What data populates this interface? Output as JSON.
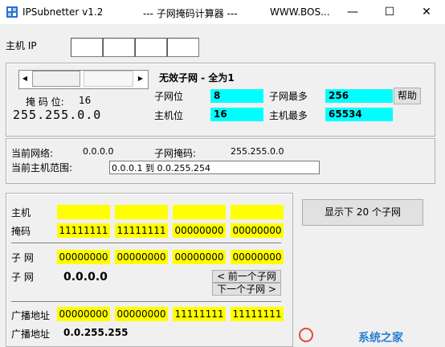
{
  "window": {
    "app_title": "IPSubnetter v1.2",
    "subtitle": "--- 子网掩码计算器 ---",
    "site": "WWW.BOS...",
    "minimize_glyph": "—",
    "maximize_glyph": "☐",
    "close_glyph": "✕"
  },
  "host_ip": {
    "label": "主机 IP",
    "octets": [
      "",
      "",
      "",
      ""
    ]
  },
  "mask_panel": {
    "scroll_left": "◀",
    "scroll_right": "▶",
    "status": "无效子网 - 全为1",
    "mask_bits_label": "掩 码 位:",
    "mask_bits_value": "16",
    "mask_value": "255.255.0.0",
    "subnet_bits_label": "子网位",
    "subnet_bits_value": "8",
    "host_bits_label": "主机位",
    "host_bits_value": "16",
    "max_subnets_label": "子网最多",
    "max_subnets_value": "256",
    "max_hosts_label": "主机最多",
    "max_hosts_value": "65534",
    "help_button": "帮助"
  },
  "info": {
    "current_network_label": "当前网络:",
    "current_network_value": "0.0.0.0",
    "subnet_mask_label": "子网掩码:",
    "subnet_mask_value": "255.255.0.0",
    "host_range_label": "当前主机范围:",
    "host_range_value": "0.0.0.1  到  0.0.255.254"
  },
  "binary": {
    "host_label": "主机",
    "host_cells": [
      "",
      "",
      "",
      ""
    ],
    "mask_label": "掩码",
    "mask_cells": [
      "11111111",
      "11111111",
      "00000000",
      "00000000"
    ],
    "subnet_label": "子 网",
    "subnet_cells": [
      "00000000",
      "00000000",
      "00000000",
      "00000000"
    ],
    "subnet_label2": "子 网",
    "subnet_value": "0.0.0.0",
    "prev_button": "< 前一个子网",
    "next_button": "下一个子网 >",
    "broadcast_label": "广播地址",
    "broadcast_cells": [
      "00000000",
      "00000000",
      "11111111",
      "11111111"
    ],
    "broadcast_label2": "广播地址",
    "broadcast_value": "0.0.255.255"
  },
  "show_button": "显示下 20 个子网",
  "watermark": "系统之家"
}
